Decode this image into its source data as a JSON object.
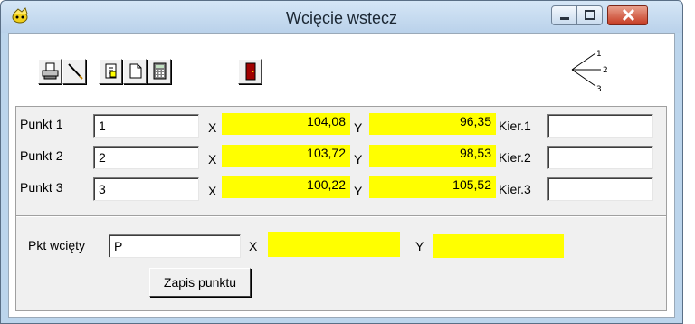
{
  "window": {
    "title": "Wcięcie wstecz",
    "buttons": {
      "minimize": "minimize",
      "maximize": "maximize",
      "close": "close"
    }
  },
  "toolbar": {
    "tools": [
      "printer-icon",
      "pencil-icon",
      "copy-document-icon",
      "new-document-icon",
      "calculator-icon",
      "exit-door-icon"
    ],
    "angle_diagram": {
      "labels": [
        "1",
        "2",
        "3"
      ]
    }
  },
  "points": [
    {
      "label": "Punkt 1",
      "number": "1",
      "x_label": "X",
      "x": "104,08",
      "y_label": "Y",
      "y": "96,35",
      "dir_label": "Kier.1",
      "dir": ""
    },
    {
      "label": "Punkt 2",
      "number": "2",
      "x_label": "X",
      "x": "103,72",
      "y_label": "Y",
      "y": "98,53",
      "dir_label": "Kier.2",
      "dir": ""
    },
    {
      "label": "Punkt 3",
      "number": "3",
      "x_label": "X",
      "x": "100,22",
      "y_label": "Y",
      "y": "105,52",
      "dir_label": "Kier.3",
      "dir": ""
    }
  ],
  "result": {
    "label": "Pkt wcięty",
    "value": "P",
    "x_label": "X",
    "x": "",
    "y_label": "Y",
    "y": "",
    "save_label": "Zapis punktu"
  },
  "colors": {
    "highlight": "#ffff00",
    "panel": "#f0f0f0",
    "frame": "#bcd5ec"
  }
}
